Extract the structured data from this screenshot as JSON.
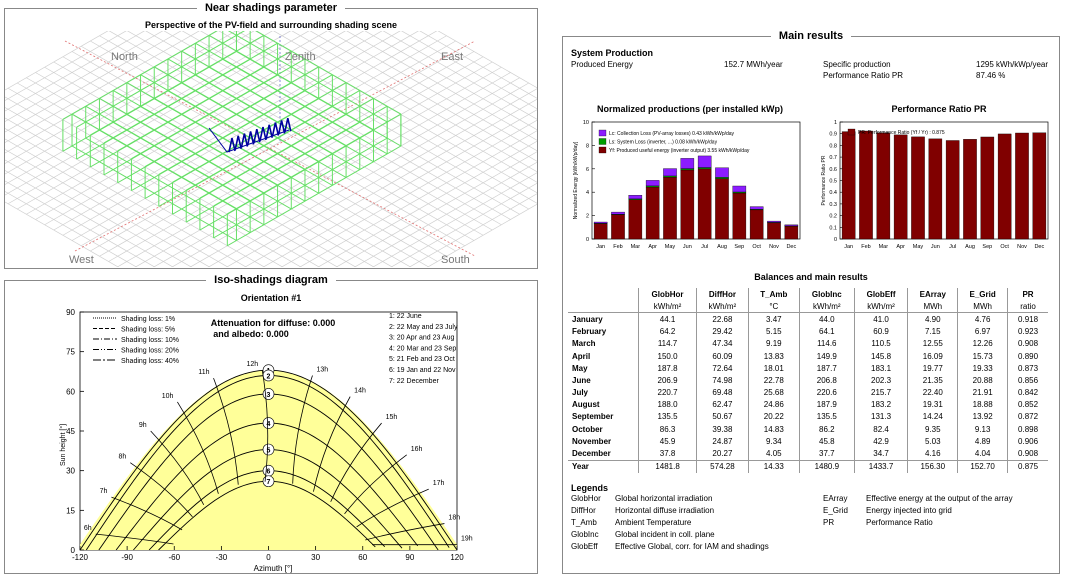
{
  "near_shadings": {
    "title": "Near shadings parameter",
    "subtitle": "Perspective of the PV-field and surrounding shading scene",
    "directions": {
      "north": "North",
      "zenith": "Zenith",
      "east": "East",
      "west": "West",
      "south": "South"
    }
  },
  "iso": {
    "title": "Iso-shadings diagram",
    "orientation": "Orientation #1",
    "attenuation_line1": "Attenuation for diffuse: 0.000",
    "attenuation_line2": "and albedo: 0.000",
    "legend": [
      "Shading loss: 1%",
      "Shading loss: 5%",
      "Shading loss: 10%",
      "Shading loss: 20%",
      "Shading loss: 40%"
    ],
    "dates": [
      "1: 22 June",
      "2: 22 May and 23 July",
      "3: 20 Apr and 23 Aug",
      "4: 20 Mar and 23 Sep",
      "5: 21 Feb and 23 Oct",
      "6: 19 Jan and 22 Nov",
      "7: 22 December"
    ],
    "hours": [
      "6h",
      "7h",
      "8h",
      "9h",
      "10h",
      "11h",
      "12h",
      "13h",
      "14h",
      "15h",
      "16h",
      "17h",
      "18h",
      "19h"
    ],
    "ylabel": "Sun height [°]",
    "xlabel": "Azimuth [°]",
    "xticks": [
      -120,
      -90,
      -60,
      -30,
      0,
      30,
      60,
      90,
      120
    ],
    "yticks": [
      0,
      15,
      30,
      45,
      60,
      75,
      90
    ]
  },
  "main": {
    "title": "Main results",
    "system_production": "System Production",
    "produced_energy_label": "Produced Energy",
    "produced_energy_value": "152.7 MWh/year",
    "specific_production_label": "Specific production",
    "specific_production_value": "1295 kWh/kWp/year",
    "pr_label": "Performance Ratio PR",
    "pr_value": "87.46 %"
  },
  "normalized_chart_title": "Normalized productions (per installed kWp)",
  "pr_chart_title": "Performance Ratio PR",
  "balances_title": "Balances and main results",
  "chart_data": [
    {
      "type": "bar",
      "title": "Normalized productions (per installed kWp)",
      "ylabel": "Normalized Energy [kWh/kWp/day]",
      "ylim": [
        0,
        10
      ],
      "yticks": [
        0,
        2,
        4,
        6,
        8,
        10
      ],
      "categories": [
        "Jan",
        "Feb",
        "Mar",
        "Apr",
        "May",
        "Jun",
        "Jul",
        "Aug",
        "Sep",
        "Oct",
        "Nov",
        "Dec"
      ],
      "stacked": true,
      "series": [
        {
          "name": "Yf: Produced useful energy  (inverter output)  3.55 kWh/kWp/day",
          "color": "#800000",
          "values": [
            1.3,
            2.07,
            3.35,
            4.44,
            5.28,
            5.9,
            5.99,
            5.16,
            3.93,
            2.49,
            1.38,
            1.09
          ]
        },
        {
          "name": "Ls: System Loss  (inverter, ...)  0.08 kWh/kWp/day",
          "color": "#00A000",
          "values": [
            0.04,
            0.05,
            0.08,
            0.1,
            0.11,
            0.12,
            0.12,
            0.11,
            0.09,
            0.06,
            0.04,
            0.03
          ]
        },
        {
          "name": "Lc: Collection Loss (PV-array losses)  0.43 kWh/kWp/day",
          "color": "#8B1CFF",
          "values": [
            0.11,
            0.18,
            0.31,
            0.47,
            0.63,
            0.87,
            0.99,
            0.82,
            0.51,
            0.22,
            0.11,
            0.09
          ]
        }
      ]
    },
    {
      "type": "bar",
      "title": "Performance Ratio PR",
      "ylabel": "Performance Ratio PR",
      "ylim": [
        0,
        1.0
      ],
      "yticks": [
        0.0,
        0.1,
        0.2,
        0.3,
        0.4,
        0.5,
        0.6,
        0.7,
        0.8,
        0.9,
        1.0
      ],
      "categories": [
        "Jan",
        "Feb",
        "Mar",
        "Apr",
        "May",
        "Jun",
        "Jul",
        "Aug",
        "Sep",
        "Oct",
        "Nov",
        "Dec"
      ],
      "series": [
        {
          "name": "PR: Performance Ratio (Yf / Yr) :  0.875",
          "color": "#800000",
          "values": [
            0.918,
            0.923,
            0.908,
            0.89,
            0.873,
            0.856,
            0.842,
            0.852,
            0.872,
            0.898,
            0.906,
            0.908
          ]
        }
      ]
    }
  ],
  "balances": {
    "headers": [
      "GlobHor",
      "DiffHor",
      "T_Amb",
      "GlobInc",
      "GlobEff",
      "EArray",
      "E_Grid",
      "PR"
    ],
    "units": [
      "kWh/m²",
      "kWh/m²",
      "°C",
      "kWh/m²",
      "kWh/m²",
      "MWh",
      "MWh",
      "ratio"
    ],
    "rows": [
      {
        "month": "January",
        "values": [
          "44.1",
          "22.68",
          "3.47",
          "44.0",
          "41.0",
          "4.90",
          "4.76",
          "0.918"
        ]
      },
      {
        "month": "February",
        "values": [
          "64.2",
          "29.42",
          "5.15",
          "64.1",
          "60.9",
          "7.15",
          "6.97",
          "0.923"
        ]
      },
      {
        "month": "March",
        "values": [
          "114.7",
          "47.34",
          "9.19",
          "114.6",
          "110.5",
          "12.55",
          "12.26",
          "0.908"
        ]
      },
      {
        "month": "April",
        "values": [
          "150.0",
          "60.09",
          "13.83",
          "149.9",
          "145.8",
          "16.09",
          "15.73",
          "0.890"
        ]
      },
      {
        "month": "May",
        "values": [
          "187.8",
          "72.64",
          "18.01",
          "187.7",
          "183.1",
          "19.77",
          "19.33",
          "0.873"
        ]
      },
      {
        "month": "June",
        "values": [
          "206.9",
          "74.98",
          "22.78",
          "206.8",
          "202.3",
          "21.35",
          "20.88",
          "0.856"
        ]
      },
      {
        "month": "July",
        "values": [
          "220.7",
          "69.48",
          "25.68",
          "220.6",
          "215.7",
          "22.40",
          "21.91",
          "0.842"
        ]
      },
      {
        "month": "August",
        "values": [
          "188.0",
          "62.47",
          "24.86",
          "187.9",
          "183.2",
          "19.31",
          "18.88",
          "0.852"
        ]
      },
      {
        "month": "September",
        "values": [
          "135.5",
          "50.67",
          "20.22",
          "135.5",
          "131.3",
          "14.24",
          "13.92",
          "0.872"
        ]
      },
      {
        "month": "October",
        "values": [
          "86.3",
          "39.38",
          "14.83",
          "86.2",
          "82.4",
          "9.35",
          "9.13",
          "0.898"
        ]
      },
      {
        "month": "November",
        "values": [
          "45.9",
          "24.87",
          "9.34",
          "45.8",
          "42.9",
          "5.03",
          "4.89",
          "0.906"
        ]
      },
      {
        "month": "December",
        "values": [
          "37.8",
          "20.27",
          "4.05",
          "37.7",
          "34.7",
          "4.16",
          "4.04",
          "0.908"
        ]
      }
    ],
    "year": {
      "label": "Year",
      "values": [
        "1481.8",
        "574.28",
        "14.33",
        "1480.9",
        "1433.7",
        "156.30",
        "152.70",
        "0.875"
      ]
    }
  },
  "legends": {
    "title": "Legends",
    "left": [
      {
        "abbr": "GlobHor",
        "desc": "Global horizontal irradiation"
      },
      {
        "abbr": "DiffHor",
        "desc": "Horizontal diffuse irradiation"
      },
      {
        "abbr": "T_Amb",
        "desc": "Ambient Temperature"
      },
      {
        "abbr": "GlobInc",
        "desc": "Global incident in coll. plane"
      },
      {
        "abbr": "GlobEff",
        "desc": "Effective Global, corr. for IAM and shadings"
      }
    ],
    "right": [
      {
        "abbr": "EArray",
        "desc": "Effective energy at the output of the array"
      },
      {
        "abbr": "E_Grid",
        "desc": "Energy injected into grid"
      },
      {
        "abbr": "PR",
        "desc": "Performance Ratio"
      }
    ]
  },
  "colors": {
    "yellow": "#FFFF99",
    "green": "#66E066",
    "dark_red": "#800000",
    "violet": "#8B1CFF",
    "system_loss_green": "#00A000"
  }
}
